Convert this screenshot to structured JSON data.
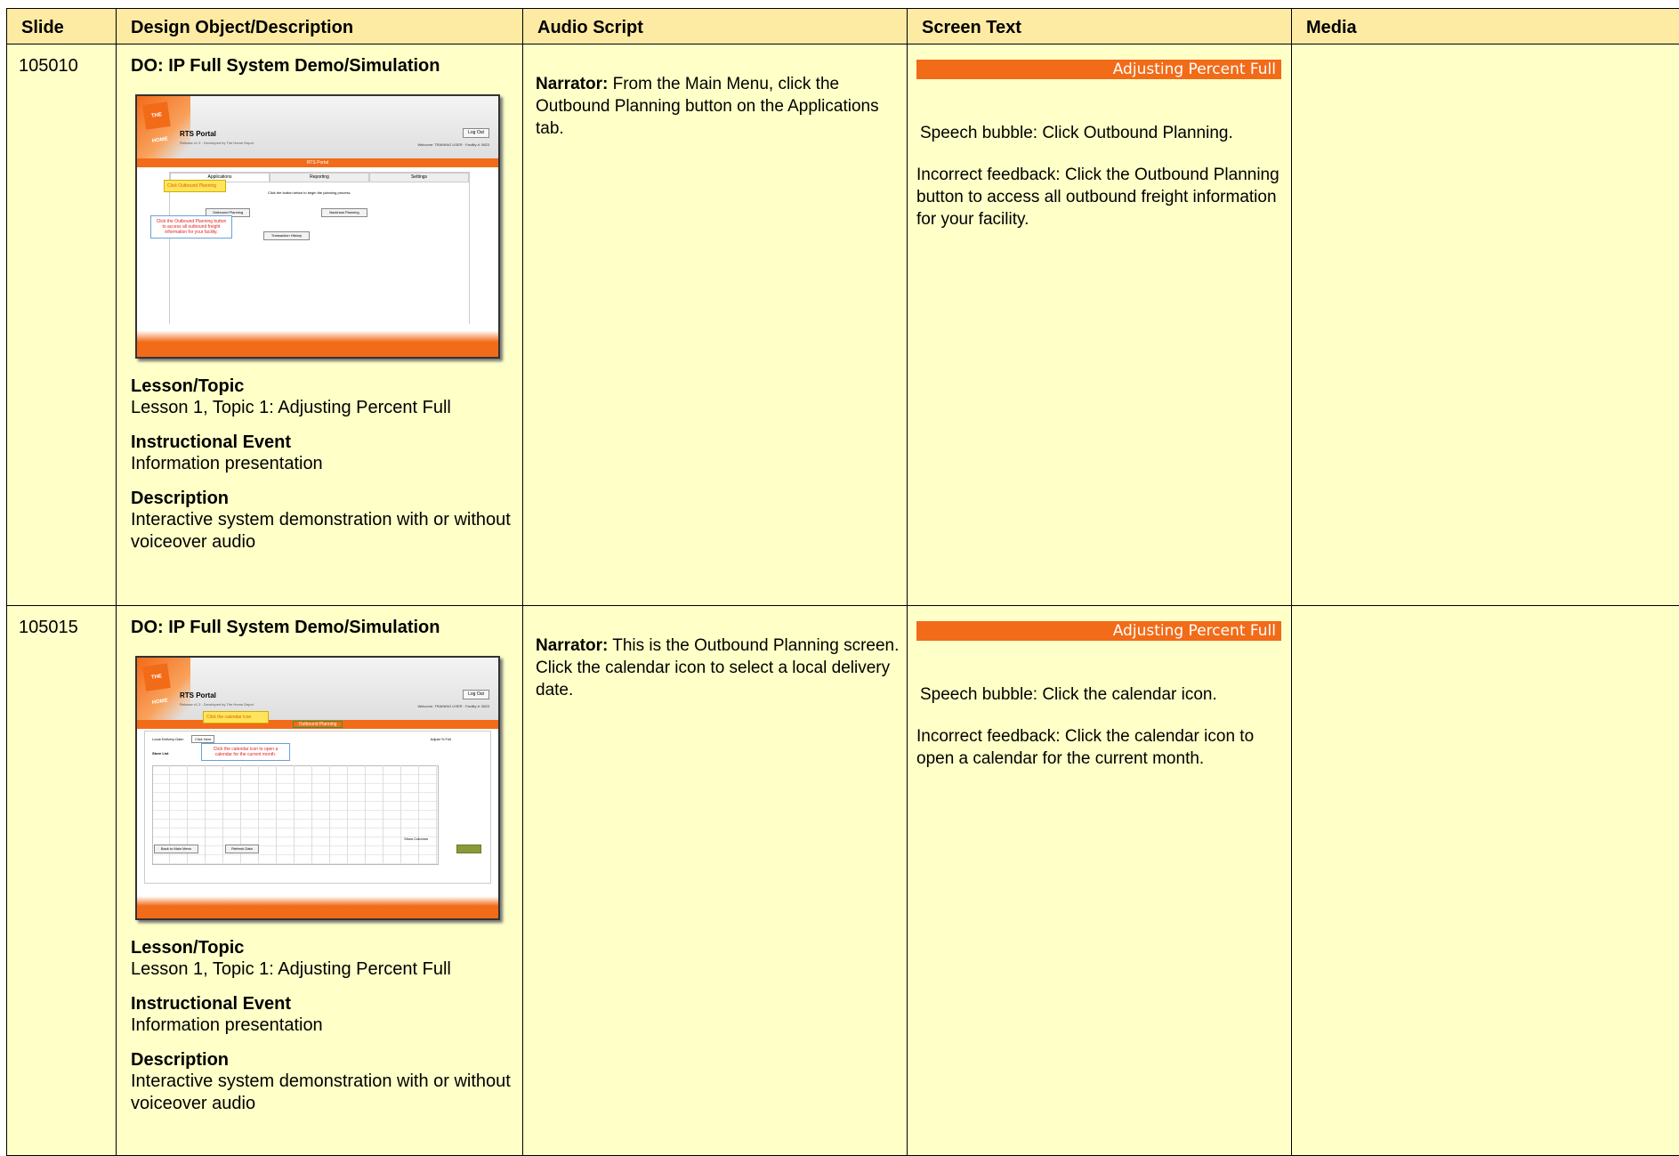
{
  "headers": {
    "slide": "Slide",
    "design": "Design Object/Description",
    "audio": "Audio Script",
    "screen": "Screen Text",
    "media": "Media"
  },
  "rows": [
    {
      "slide": "105010",
      "do_title": "DO: IP Full System Demo/Simulation",
      "lesson_h": "Lesson/Topic",
      "lesson": "Lesson 1, Topic 1: Adjusting Percent Full",
      "event_h": "Instructional Event",
      "event": "Information presentation",
      "desc_h": "Description",
      "desc": "Interactive system demonstration with or without voiceover audio",
      "narrator_label": "Narrator:",
      "narration": "From the Main Menu, click the Outbound Planning button on the Applications tab.",
      "banner": "Adjusting Percent Full",
      "bubble": "Speech bubble: Click Outbound Planning.",
      "feedback": "Incorrect feedback: Click the Outbound Planning button to access all outbound freight information for your facility.",
      "media": "",
      "thumb": {
        "logo": "THE HOME DEPOT",
        "portal_title": "RTS Portal",
        "portal_sub": "Release v1.3 · Developed by The Home Depot",
        "logout": "Log Out",
        "welcome": "Welcome: TRAINING USER · Facility #: 5823",
        "bar": "RTS Portal",
        "tabs": [
          "Applications",
          "Reporting",
          "Settings"
        ],
        "instruction": "Click the button below to begin the planning process",
        "btn_outbound": "Outbound Planning",
        "btn_backhaul": "Backhaul Planning",
        "btn_history": "Transaction History",
        "callout": "Click Outbound Planning",
        "fb": "Click the Outbound Planning button to access all outbound freight information for your facility."
      }
    },
    {
      "slide": "105015",
      "do_title": "DO: IP Full System Demo/Simulation",
      "lesson_h": "Lesson/Topic",
      "lesson": "Lesson 1, Topic 1: Adjusting Percent Full",
      "event_h": "Instructional Event",
      "event": "Information presentation",
      "desc_h": "Description",
      "desc": "Interactive system demonstration with or without voiceover audio",
      "narrator_label": "Narrator:",
      "narration": "This is the Outbound Planning screen. Click the calendar icon to select a local delivery date.",
      "banner": "Adjusting Percent Full",
      "bubble": "Speech bubble: Click the calendar icon.",
      "feedback": "Incorrect feedback: Click the calendar icon to open a calendar for the current month.",
      "media": "",
      "thumb": {
        "logo": "THE HOME DEPOT",
        "portal_title": "RTS Portal",
        "portal_sub": "Release v1.3 · Developed by The Home Depot",
        "logout": "Log Out",
        "welcome": "Welcome: TRAINING USER · Facility #: 5823",
        "bar": "Outbound Planning",
        "date_label": "Local Delivery Date:",
        "date_value": "Click Here",
        "store_list": "Store List",
        "adjust": "Adjust % Full",
        "callout": "Click the calendar icon",
        "fb": "Click the calendar icon to open a calendar for the current month.",
        "btn_main": "Back to Main Menu",
        "btn_refresh": "Refresh Data",
        "show_columns": "Show Columns"
      }
    }
  ]
}
